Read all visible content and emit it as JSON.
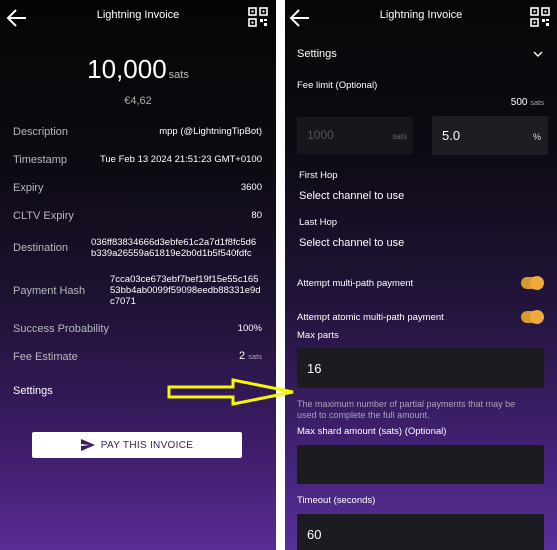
{
  "left": {
    "header_title": "Lightning Invoice",
    "amount": "10,000",
    "amount_unit": "sats",
    "fiat": "€4,62",
    "rows": [
      {
        "label": "Description",
        "value": "mpp (@LightningTipBot)"
      },
      {
        "label": "Timestamp",
        "value": "Tue Feb 13 2024 21:51:23 GMT+0100"
      },
      {
        "label": "Expiry",
        "value": "3600"
      },
      {
        "label": "CLTV Expiry",
        "value": "80"
      },
      {
        "label": "Destination",
        "value_lines": [
          "036ff83834666d3ebfe61c2a7d1f8fc5d6",
          "b339a26559a61819e2b0d1b5f540fdfc"
        ]
      },
      {
        "label": "Payment Hash",
        "value_lines": [
          "7cca03ce673ebf7bef19f15e55c165",
          "53bb4ab0099f59098eedb88331e9d",
          "c7071"
        ]
      },
      {
        "label": "Success Probability",
        "value": "100%"
      },
      {
        "label": "Fee Estimate",
        "value": "2",
        "unit": "sats"
      }
    ],
    "settings_label": "Settings",
    "pay_button": "PAY THIS INVOICE"
  },
  "right": {
    "header_title": "Lightning Invoice",
    "settings_label": "Settings",
    "fee_limit_label": "Fee limit (Optional)",
    "fee_limit_value": "500",
    "fee_limit_unit": "sats",
    "fee_sats_placeholder": "1000",
    "fee_sats_unit": "sats",
    "fee_percent_value": "5.0",
    "fee_percent_unit": "%",
    "first_hop_label": "First Hop",
    "first_hop_value": "Select channel to use",
    "last_hop_label": "Last Hop",
    "last_hop_value": "Select channel to use",
    "mpp_label": "Attempt multi-path payment",
    "amp_label": "Attempt atomic multi-path payment",
    "max_parts_label": "Max parts",
    "max_parts_value": "16",
    "max_parts_help_1": "The maximum number of partial payments that may be",
    "max_parts_help_2": "used to complete the full amount.",
    "max_shard_label": "Max shard amount (sats) (Optional)",
    "timeout_label": "Timeout (seconds)",
    "timeout_value": "60"
  },
  "colors": {
    "toggle_on": "#f2a93b",
    "arrow": "#f7f700",
    "accent": "#3a1c5e"
  },
  "icons": [
    "back-arrow-icon",
    "qr-code-icon",
    "chevron-down-icon",
    "send-icon"
  ]
}
